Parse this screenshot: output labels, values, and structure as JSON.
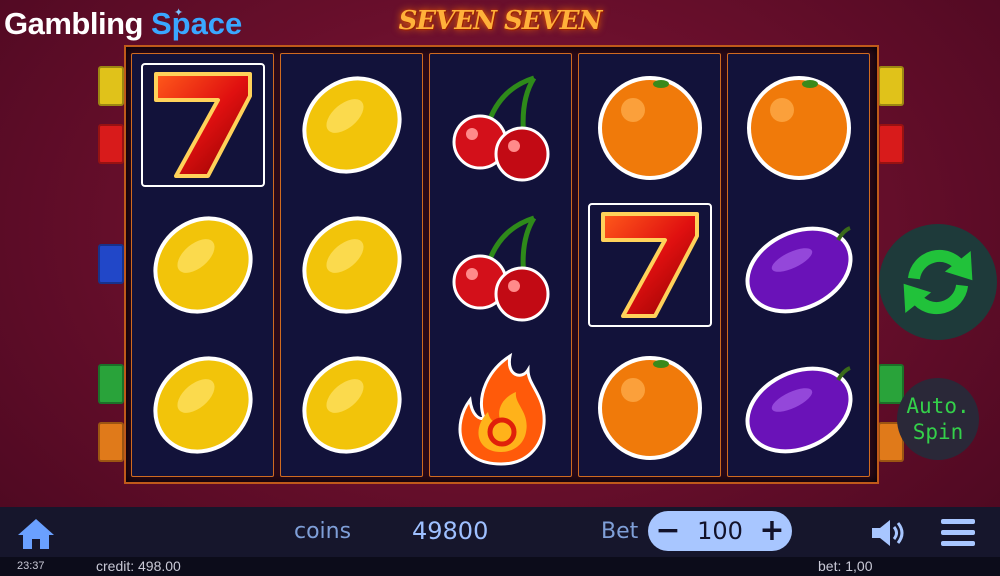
{
  "header": {
    "brand_part1": "Gambling",
    "brand_part2": "Space",
    "game_title": "SEVEN SEVEN"
  },
  "reels": [
    [
      "seven",
      "lemon",
      "lemon"
    ],
    [
      "lemon",
      "lemon",
      "lemon"
    ],
    [
      "cherry",
      "cherry",
      "fire"
    ],
    [
      "orange",
      "seven",
      "orange"
    ],
    [
      "orange",
      "plum",
      "plum"
    ]
  ],
  "controls": {
    "auto_spin_line1": "Auto.",
    "auto_spin_line2": "Spin"
  },
  "bottom_bar": {
    "coins_label": "coins",
    "coins_value": "49800",
    "bet_label": "Bet",
    "bet_value": "100",
    "minus": "−",
    "plus": "+"
  },
  "status_bar": {
    "time": "23:37",
    "credit": "credit: 498.00",
    "bet": "bet: 1,00"
  },
  "colors": {
    "background": "#6a0f2c",
    "reel_bg": "#12123a",
    "spin_green": "#21c23a",
    "bet_pill": "#a8c6ff",
    "coins_text": "#9ec0ff"
  },
  "icons": [
    "home-icon",
    "speaker-icon",
    "menu-icon",
    "spin-arrows-icon"
  ]
}
